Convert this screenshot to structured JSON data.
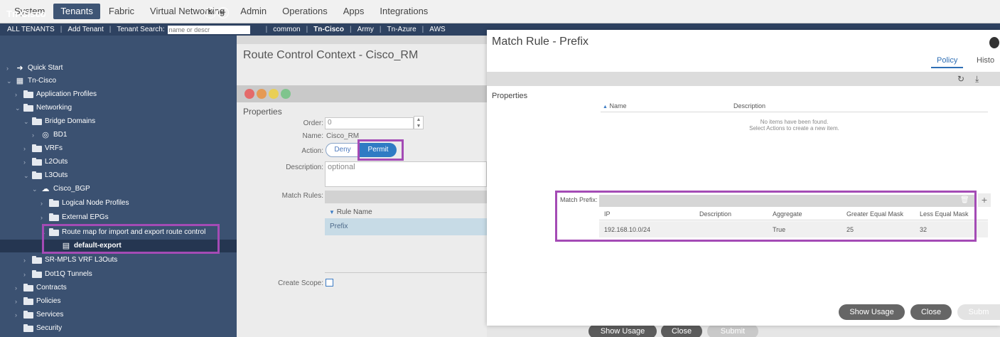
{
  "topnav": {
    "tabs": [
      "System",
      "Tenants",
      "Fabric",
      "Virtual Networking",
      "Admin",
      "Operations",
      "Apps",
      "Integrations"
    ]
  },
  "subnav": {
    "all_tenants": "ALL TENANTS",
    "add_tenant": "Add Tenant",
    "tenant_search_label": "Tenant Search:",
    "tenant_search_placeholder": "name or descr",
    "tenants": [
      "common",
      "Tn-Cisco",
      "Army",
      "Tn-Azure",
      "AWS"
    ]
  },
  "tree": {
    "title": "Tn-Cisco",
    "nodes": [
      {
        "label": "Quick Start"
      },
      {
        "label": "Tn-Cisco"
      },
      {
        "label": "Application Profiles"
      },
      {
        "label": "Networking"
      },
      {
        "label": "Bridge Domains"
      },
      {
        "label": "BD1"
      },
      {
        "label": "VRFs"
      },
      {
        "label": "L2Outs"
      },
      {
        "label": "L3Outs"
      },
      {
        "label": "Cisco_BGP"
      },
      {
        "label": "Logical Node Profiles"
      },
      {
        "label": "External EPGs"
      },
      {
        "label": "Route map for import and export route control"
      },
      {
        "label": "default-export"
      },
      {
        "label": "SR-MPLS VRF L3Outs"
      },
      {
        "label": "Dot1Q Tunnels"
      },
      {
        "label": "Contracts"
      },
      {
        "label": "Policies"
      },
      {
        "label": "Services"
      },
      {
        "label": "Security"
      }
    ]
  },
  "context": {
    "title": "Route Control Context - Cisco_RM",
    "properties_label": "Properties",
    "order_label": "Order:",
    "order_value": "0",
    "name_label": "Name:",
    "name_value": "Cisco_RM",
    "action_label": "Action:",
    "action_deny": "Deny",
    "action_permit": "Permit",
    "description_label": "Description:",
    "description_placeholder": "optional",
    "match_rules_label": "Match Rules:",
    "rule_name_header": "Rule Name",
    "rule_row": "Prefix",
    "create_scope_label": "Create Scope:",
    "bg_show_usage": "Show Usage",
    "bg_close": "Close",
    "bg_submit": "Submit"
  },
  "modal": {
    "title": "Match Rule - Prefix",
    "tab_policy": "Policy",
    "tab_history": "Histo",
    "properties_label": "Properties",
    "th_name": "Name",
    "th_description": "Description",
    "empty_line1": "No items have been found.",
    "empty_line2": "Select Actions to create a new item.",
    "match_prefix_label": "Match Prefix:",
    "prefix_headers": {
      "ip": "IP",
      "description": "Description",
      "aggregate": "Aggregate",
      "ge_mask": "Greater Equal Mask",
      "le_mask": "Less Equal Mask"
    },
    "prefix_row": {
      "ip": "192.168.10.0/24",
      "description": "",
      "aggregate": "True",
      "ge_mask": "25",
      "le_mask": "32"
    },
    "btn_show_usage": "Show Usage",
    "btn_close": "Close",
    "btn_submit": "Subm"
  },
  "colors": {
    "highlight": "#a44bb5",
    "tree_bg": "#3b5171",
    "accent": "#2f7bc4"
  }
}
